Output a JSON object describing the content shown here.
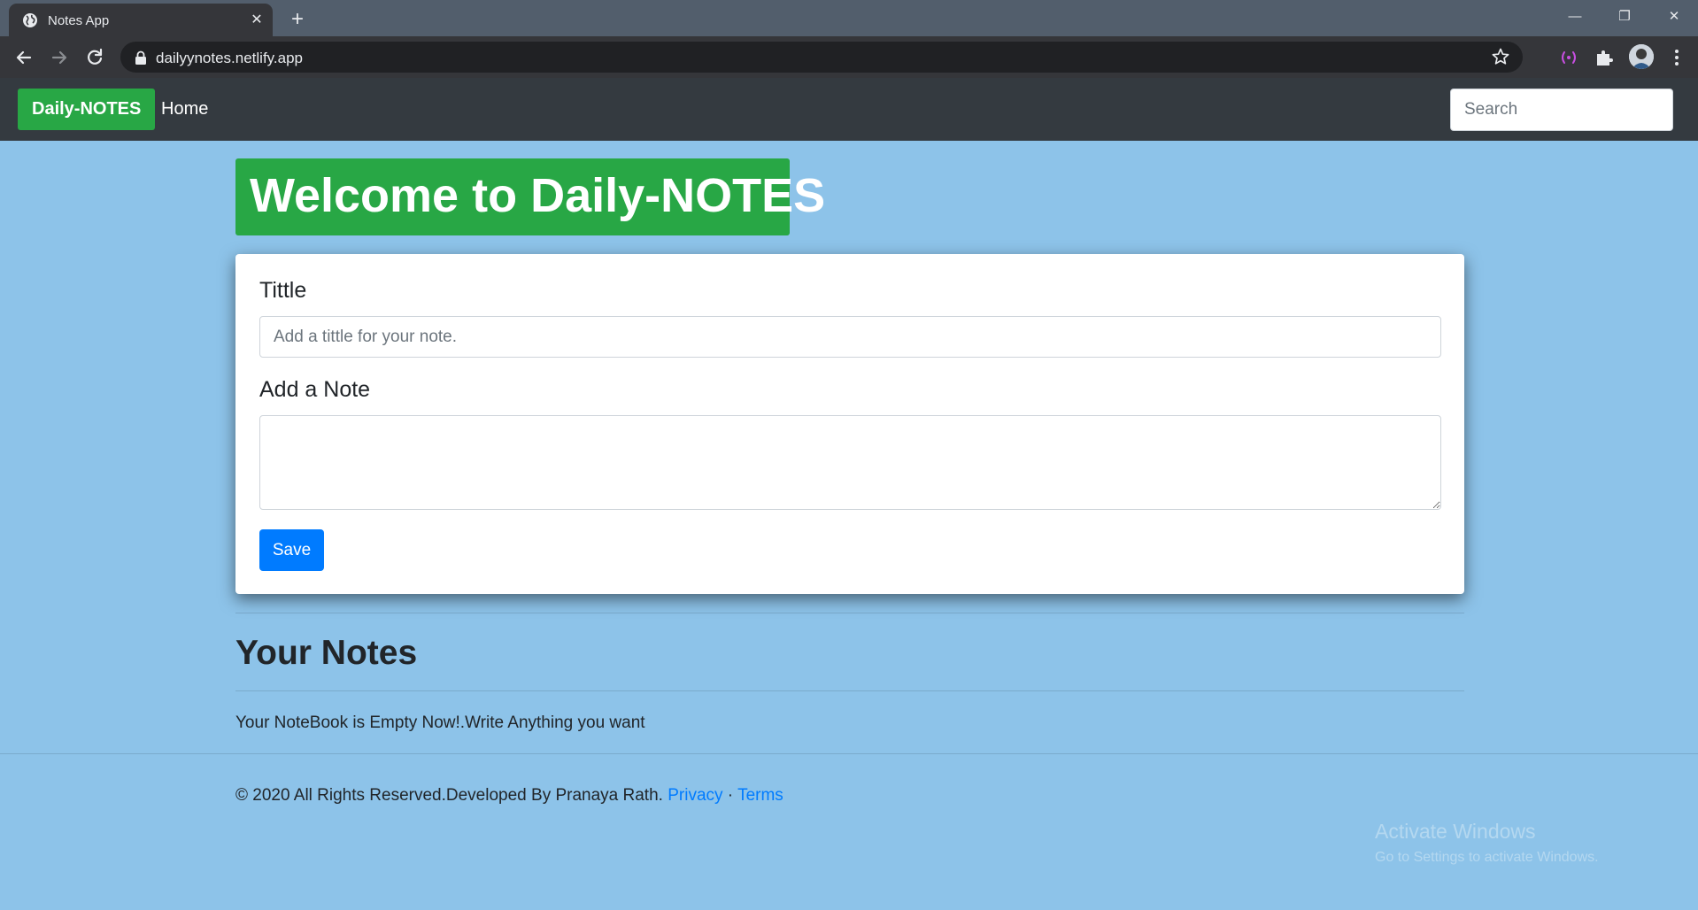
{
  "browser": {
    "tab_title": "Notes App",
    "new_tab_symbol": "+",
    "close_symbol": "✕",
    "url": "dailyynotes.netlify.app",
    "window_controls": {
      "minimize": "—",
      "restore": "❐",
      "close": "✕"
    }
  },
  "navbar": {
    "brand": "Daily-NOTES",
    "home_link": "Home",
    "search_placeholder": "Search"
  },
  "welcome": {
    "heading": "Welcome to Daily-NOTES"
  },
  "form": {
    "title_label": "Tittle",
    "title_placeholder": "Add a tittle for your note.",
    "title_value": "",
    "note_label": "Add a Note",
    "note_value": "",
    "save_label": "Save"
  },
  "notes": {
    "heading": "Your Notes",
    "empty_message": "Your NoteBook is Empty Now!.Write Anything you want"
  },
  "footer": {
    "text": "© 2020 All Rights Reserved.Developed By Pranaya Rath.",
    "privacy": "Privacy",
    "separator": "·",
    "terms": "Terms"
  },
  "watermark": {
    "line1": "Activate Windows",
    "line2": "Go to Settings to activate Windows."
  },
  "colors": {
    "page_bg": "#8dc3e9",
    "navbar_bg": "#343a40",
    "brand_green": "#28a745",
    "primary_blue": "#007bff"
  },
  "icons": [
    "globe-icon",
    "close-icon",
    "plus-icon",
    "back-icon",
    "forward-icon",
    "reload-icon",
    "lock-icon",
    "star-icon",
    "extension-cast-icon",
    "puzzle-icon",
    "avatar",
    "kebab-menu-icon"
  ]
}
